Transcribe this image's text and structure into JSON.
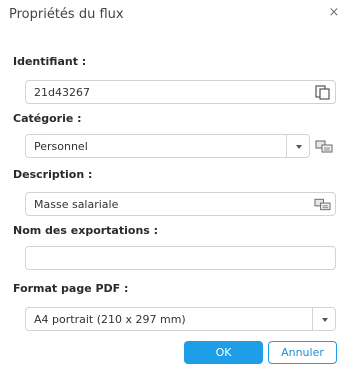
{
  "dialog": {
    "title": "Propriétés du flux",
    "close_glyph": "×"
  },
  "fields": {
    "identifiant": {
      "label": "Identifiant :",
      "value": "21d43267",
      "icon": "copy-icon"
    },
    "categorie": {
      "label": "Catégorie :",
      "value": "Personnel",
      "icon": "translate-icon"
    },
    "description": {
      "label": "Description :",
      "value": "Masse salariale",
      "icon": "translate-icon"
    },
    "exportations": {
      "label": "Nom des exportations :",
      "value": "",
      "placeholder": ""
    },
    "format": {
      "label": "Format page PDF :",
      "value": "A4 portrait (210 x 297 mm)"
    }
  },
  "buttons": {
    "ok": "OK",
    "cancel": "Annuler"
  },
  "colors": {
    "accent": "#1d9ee6",
    "border": "#d3d3d3"
  }
}
